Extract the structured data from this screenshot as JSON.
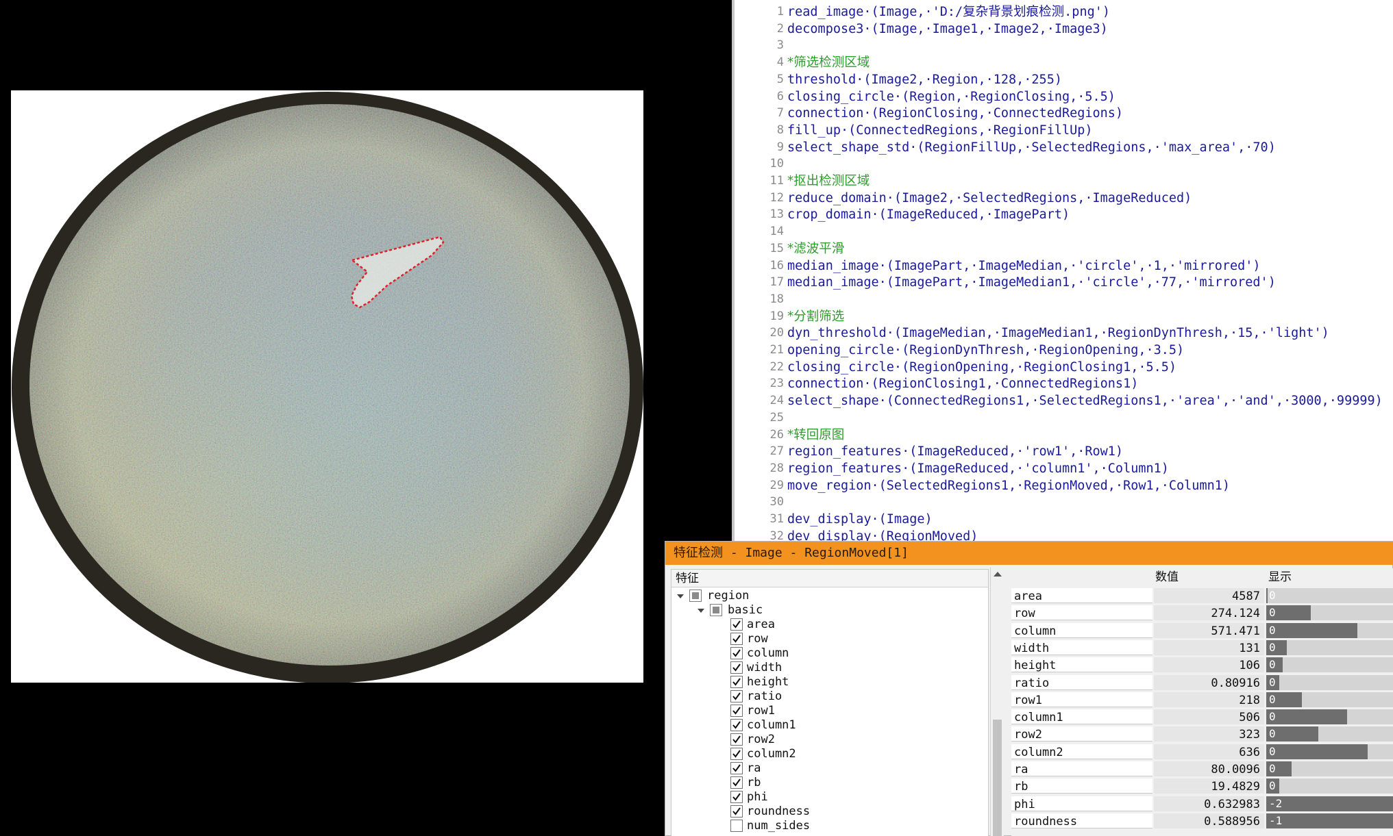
{
  "editor": {
    "lines": [
      {
        "n": "1",
        "text": "read_image·(Image,·'D:/复杂背景划痕检测.png')",
        "comment": false
      },
      {
        "n": "2",
        "text": "decompose3·(Image,·Image1,·Image2,·Image3)",
        "comment": false
      },
      {
        "n": "3",
        "text": "",
        "comment": false
      },
      {
        "n": "4",
        "text": "*筛选检测区域",
        "comment": true
      },
      {
        "n": "5",
        "text": "threshold·(Image2,·Region,·128,·255)",
        "comment": false
      },
      {
        "n": "6",
        "text": "closing_circle·(Region,·RegionClosing,·5.5)",
        "comment": false
      },
      {
        "n": "7",
        "text": "connection·(RegionClosing,·ConnectedRegions)",
        "comment": false
      },
      {
        "n": "8",
        "text": "fill_up·(ConnectedRegions,·RegionFillUp)",
        "comment": false
      },
      {
        "n": "9",
        "text": "select_shape_std·(RegionFillUp,·SelectedRegions,·'max_area',·70)",
        "comment": false
      },
      {
        "n": "10",
        "text": "",
        "comment": false
      },
      {
        "n": "11",
        "text": "*抠出检测区域",
        "comment": true
      },
      {
        "n": "12",
        "text": "reduce_domain·(Image2,·SelectedRegions,·ImageReduced)",
        "comment": false
      },
      {
        "n": "13",
        "text": "crop_domain·(ImageReduced,·ImagePart)",
        "comment": false
      },
      {
        "n": "14",
        "text": "",
        "comment": false
      },
      {
        "n": "15",
        "text": "*滤波平滑",
        "comment": true
      },
      {
        "n": "16",
        "text": "median_image·(ImagePart,·ImageMedian,·'circle',·1,·'mirrored')",
        "comment": false
      },
      {
        "n": "17",
        "text": "median_image·(ImagePart,·ImageMedian1,·'circle',·77,·'mirrored')",
        "comment": false
      },
      {
        "n": "18",
        "text": "",
        "comment": false
      },
      {
        "n": "19",
        "text": "*分割筛选",
        "comment": true
      },
      {
        "n": "20",
        "text": "dyn_threshold·(ImageMedian,·ImageMedian1,·RegionDynThresh,·15,·'light')",
        "comment": false
      },
      {
        "n": "21",
        "text": "opening_circle·(RegionDynThresh,·RegionOpening,·3.5)",
        "comment": false
      },
      {
        "n": "22",
        "text": "closing_circle·(RegionOpening,·RegionClosing1,·5.5)",
        "comment": false
      },
      {
        "n": "23",
        "text": "connection·(RegionClosing1,·ConnectedRegions1)",
        "comment": false
      },
      {
        "n": "24",
        "text": "select_shape·(ConnectedRegions1,·SelectedRegions1,·'area',·'and',·3000,·99999)",
        "comment": false
      },
      {
        "n": "25",
        "text": "",
        "comment": false
      },
      {
        "n": "26",
        "text": "*转回原图",
        "comment": true
      },
      {
        "n": "27",
        "text": "region_features·(ImageReduced,·'row1',·Row1)",
        "comment": false
      },
      {
        "n": "28",
        "text": "region_features·(ImageReduced,·'column1',·Column1)",
        "comment": false
      },
      {
        "n": "29",
        "text": "move_region·(SelectedRegions1,·RegionMoved,·Row1,·Column1)",
        "comment": false
      },
      {
        "n": "30",
        "text": "",
        "comment": false
      },
      {
        "n": "31",
        "text": "dev_display·(Image)",
        "comment": false
      },
      {
        "n": "32",
        "text": "dev_display·(RegionMoved)",
        "comment": false
      }
    ]
  },
  "dialog": {
    "title": "特征检测 - Image - RegionMoved[1]",
    "tree_header": "特征",
    "values_header_value": "数值",
    "values_header_display": "显示",
    "tree": [
      {
        "label": "region",
        "kind": "group",
        "level": 0,
        "expanded": true
      },
      {
        "label": "basic",
        "kind": "group",
        "level": 1,
        "expanded": true
      },
      {
        "label": "area",
        "kind": "feature",
        "checked": true
      },
      {
        "label": "row",
        "kind": "feature",
        "checked": true
      },
      {
        "label": "column",
        "kind": "feature",
        "checked": true
      },
      {
        "label": "width",
        "kind": "feature",
        "checked": true
      },
      {
        "label": "height",
        "kind": "feature",
        "checked": true
      },
      {
        "label": "ratio",
        "kind": "feature",
        "checked": true
      },
      {
        "label": "row1",
        "kind": "feature",
        "checked": true
      },
      {
        "label": "column1",
        "kind": "feature",
        "checked": true
      },
      {
        "label": "row2",
        "kind": "feature",
        "checked": true
      },
      {
        "label": "column2",
        "kind": "feature",
        "checked": true
      },
      {
        "label": "ra",
        "kind": "feature",
        "checked": true
      },
      {
        "label": "rb",
        "kind": "feature",
        "checked": true
      },
      {
        "label": "phi",
        "kind": "feature",
        "checked": true
      },
      {
        "label": "roundness",
        "kind": "feature",
        "checked": true
      },
      {
        "label": "num_sides",
        "kind": "feature",
        "checked": false
      }
    ],
    "values": [
      {
        "name": "area",
        "value": "4587",
        "bar_label": "0",
        "bar_fill": 0.01
      },
      {
        "name": "row",
        "value": "274.124",
        "bar_label": "0",
        "bar_fill": 0.35
      },
      {
        "name": "column",
        "value": "571.471",
        "bar_label": "0",
        "bar_fill": 0.72
      },
      {
        "name": "width",
        "value": "131",
        "bar_label": "0",
        "bar_fill": 0.16
      },
      {
        "name": "height",
        "value": "106",
        "bar_label": "0",
        "bar_fill": 0.13
      },
      {
        "name": "ratio",
        "value": "0.80916",
        "bar_label": "0",
        "bar_fill": 0.1
      },
      {
        "name": "row1",
        "value": "218",
        "bar_label": "0",
        "bar_fill": 0.28
      },
      {
        "name": "column1",
        "value": "506",
        "bar_label": "0",
        "bar_fill": 0.64
      },
      {
        "name": "row2",
        "value": "323",
        "bar_label": "0",
        "bar_fill": 0.41
      },
      {
        "name": "column2",
        "value": "636",
        "bar_label": "0",
        "bar_fill": 0.8
      },
      {
        "name": "ra",
        "value": "80.0096",
        "bar_label": "0",
        "bar_fill": 0.2
      },
      {
        "name": "rb",
        "value": "19.4829",
        "bar_label": "0",
        "bar_fill": 0.1
      },
      {
        "name": "phi",
        "value": "0.632983",
        "bar_label": "-2",
        "bar_fill": 1.0
      },
      {
        "name": "roundness",
        "value": "0.588956",
        "bar_label": "-1",
        "bar_fill": 1.0
      }
    ]
  },
  "colors": {
    "title_bar": "#f3921f",
    "code_text": "#1a1a9a",
    "comment_text": "#2e9b2e",
    "region_outline": "#e0202a",
    "disc_rim": "#2a2620"
  }
}
